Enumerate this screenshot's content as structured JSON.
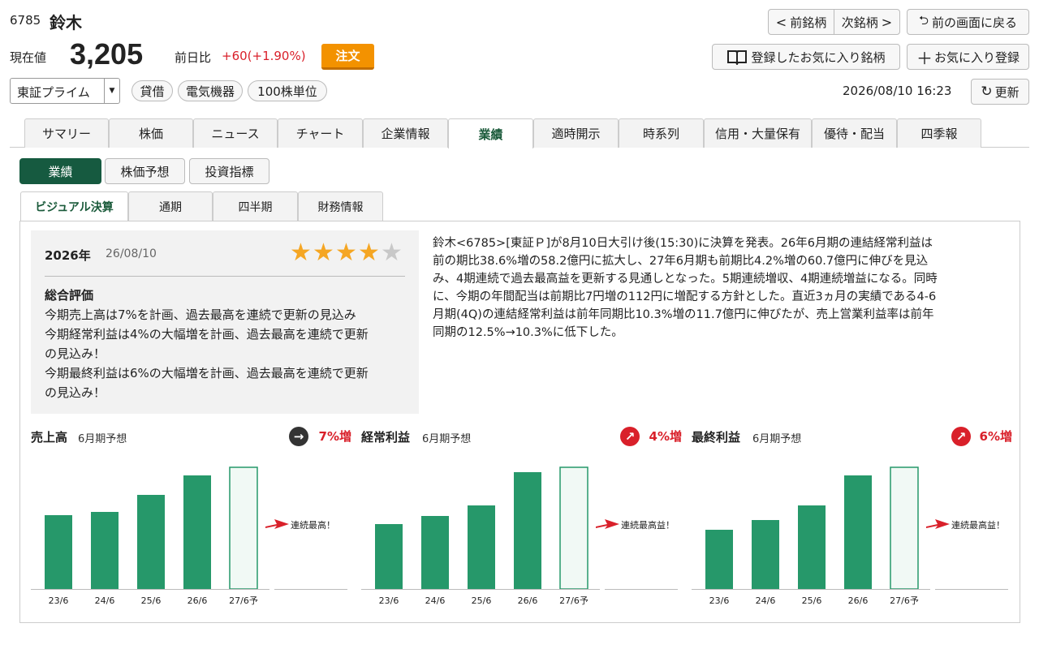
{
  "stock": {
    "code": "6785",
    "name": "鈴木",
    "price_label": "現在値",
    "price": "3,205",
    "change_label": "前日比",
    "change": "+60(+1.90%)",
    "order_button": "注文",
    "market": "東証プライム",
    "tags": [
      "貸借",
      "電気機器",
      "100株単位"
    ],
    "timestamp": "2026/08/10 16:23"
  },
  "nav": {
    "prev": "前銘柄",
    "next": "次銘柄",
    "back": "前の画面に戻る",
    "watchlist": "登録したお気に入り銘柄",
    "add_favorite": "お気に入り登録",
    "refresh": "更新"
  },
  "tabs": [
    "サマリー",
    "株価",
    "ニュース",
    "チャート",
    "企業情報",
    "業績",
    "適時開示",
    "時系列",
    "信用・大量保有",
    "優待・配当",
    "四季報"
  ],
  "active_tab": "業績",
  "subtabs": [
    "業績",
    "株価予想",
    "投資指標"
  ],
  "panel_tabs": [
    "ビジュアル決算",
    "通期",
    "四半期",
    "財務情報"
  ],
  "summary": {
    "year": "2026年",
    "date": "26/08/10",
    "rating": 4,
    "rating_max": 5,
    "heading": "総合評価",
    "lines": [
      "今期売上高は7%を計画、過去最高を連続で更新の見込み",
      "今期経常利益は4%の大幅増を計画、過去最高を連続で更新",
      "の見込み！",
      "今期最終利益は6%の大幅増を計画、過去最高を連続で更新",
      "の見込み！"
    ]
  },
  "article": {
    "lines": [
      "鈴木<6785>[東証Ｐ]が8月10日大引け後(15:30)に決算を発表。26年6月期の連結経常利益は",
      "前の期比38.6%増の58.2億円に拡大し、27年6月期も前期比4.2%増の60.7億円に伸びを見込",
      "み、4期連続で過去最高益を更新する見通しとなった。5期連続増収、4期連続増益になる。同時",
      "に、今期の年間配当は前期比7円増の112円に増配する方針とした。直近3ヵ月の実績である4-6",
      "月期(4Q)の連結経常利益は前年同期比10.3%増の11.7億円に伸びたが、売上営業利益率は前年",
      "同期の12.5%→10.3%に低下した。"
    ]
  },
  "chart_data": [
    {
      "type": "bar",
      "title": "売上高",
      "subtitle": "6月期予想",
      "change": "7%増",
      "trend_icon": "arrow-right-icon",
      "categories": [
        "23/6",
        "24/6",
        "25/6",
        "26/6",
        "27/6予"
      ],
      "values": [
        91,
        95,
        116,
        140,
        150
      ],
      "forecast_index": 4,
      "annotation": "連続最高！",
      "color": "#26986a",
      "ylim": [
        0,
        150
      ]
    },
    {
      "type": "bar",
      "title": "経常利益",
      "subtitle": "6月期予想",
      "change": "4%増",
      "trend_icon": "arrow-up-right-icon",
      "categories": [
        "23/6",
        "24/6",
        "25/6",
        "26/6",
        "27/6予"
      ],
      "values": [
        80,
        90,
        103,
        144,
        150
      ],
      "forecast_index": 4,
      "annotation": "連続最高益！",
      "color": "#26986a",
      "ylim": [
        0,
        150
      ]
    },
    {
      "type": "bar",
      "title": "最終利益",
      "subtitle": "6月期予想",
      "change": "6%増",
      "trend_icon": "arrow-up-right-icon",
      "categories": [
        "23/6",
        "24/6",
        "25/6",
        "26/6",
        "27/6予"
      ],
      "values": [
        73,
        85,
        103,
        140,
        150
      ],
      "forecast_index": 4,
      "annotation": "連続最高益！",
      "color": "#26986a",
      "ylim": [
        0,
        150
      ]
    }
  ],
  "colors": {
    "accent_green": "#165a40",
    "bar_green": "#26986a",
    "up_red": "#d9202a",
    "order_orange": "#f39200",
    "star_gold": "#f5a623"
  }
}
